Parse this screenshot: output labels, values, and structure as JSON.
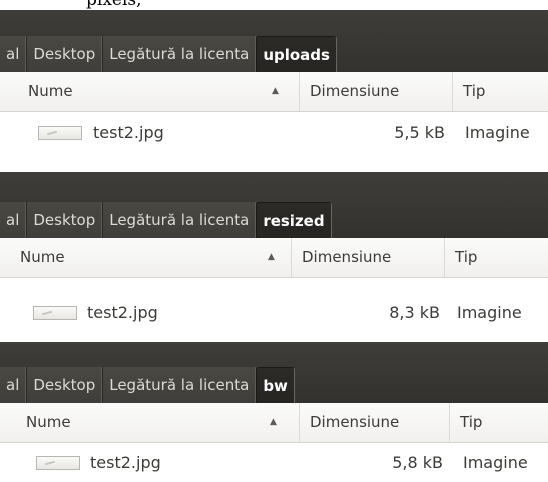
{
  "caption_fragment": "pixels,",
  "columns": {
    "name": "Nume",
    "size": "Dimensiune",
    "type": "Tip"
  },
  "panels": [
    {
      "breadcrumbs": [
        "al",
        "Desktop",
        "Legătură la licenta",
        "uploads"
      ],
      "active_index": 3,
      "file": {
        "name": "test2.jpg",
        "size": "5,5 kB",
        "type": "Imagine"
      }
    },
    {
      "breadcrumbs": [
        "al",
        "Desktop",
        "Legătură la licenta",
        "resized"
      ],
      "active_index": 3,
      "file": {
        "name": "test2.jpg",
        "size": "8,3 kB",
        "type": "Imagine"
      }
    },
    {
      "breadcrumbs": [
        "al",
        "Desktop",
        "Legătură la licenta",
        "bw"
      ],
      "active_index": 3,
      "file": {
        "name": "test2.jpg",
        "size": "5,8 kB",
        "type": "Imagine"
      }
    }
  ],
  "colors": {
    "pathbar": "#3a3834",
    "active_crumb": "#282724",
    "header_bg": "#f4f3f1"
  },
  "icons": {
    "sort": "sort-ascending-icon",
    "file": "image-file-icon"
  }
}
